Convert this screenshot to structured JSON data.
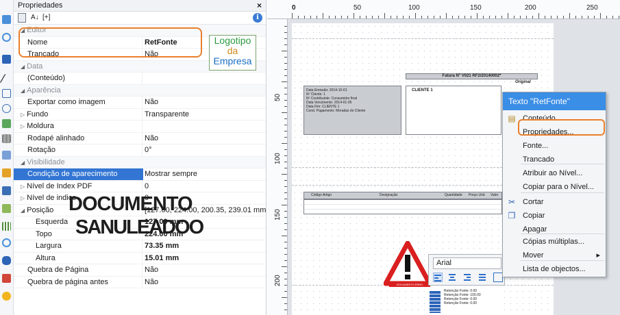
{
  "panel": {
    "title": "Propriedades",
    "close": "×",
    "sort_az": "A↓",
    "sort_cat": "[+]",
    "info": "i"
  },
  "grid": [
    {
      "type": "cat",
      "key": "Editor"
    },
    {
      "type": "prop",
      "key": "Nome",
      "value": "RetFonte",
      "bold_value": true
    },
    {
      "type": "prop",
      "key": "Trancado",
      "value": "Não"
    },
    {
      "type": "cat",
      "key": "Data"
    },
    {
      "type": "prop",
      "key": "(Conteúdo)",
      "value": ""
    },
    {
      "type": "cat",
      "key": "Aparência"
    },
    {
      "type": "prop",
      "key": "Exportar como imagem",
      "value": "Não"
    },
    {
      "type": "prop",
      "key": "Fundo",
      "value": "Transparente",
      "expand": true
    },
    {
      "type": "prop",
      "key": "Moldura",
      "value": "",
      "expand": true
    },
    {
      "type": "prop",
      "key": "Rodapé alinhado",
      "value": "Não"
    },
    {
      "type": "prop",
      "key": "Rotação",
      "value": "0°"
    },
    {
      "type": "cat",
      "key": "Visibilidade"
    },
    {
      "type": "prop",
      "key": "Condição de aparecimento",
      "value": "Mostrar sempre",
      "selected": true
    },
    {
      "type": "prop",
      "key": "Nível de Index PDF",
      "value": "0",
      "expand": true
    },
    {
      "type": "prop",
      "key": "Nível de indice",
      "value": "0",
      "expand": true
    },
    {
      "type": "prop",
      "key": "Posição",
      "value": "[127.00, 224.00, 200.35, 239.01 mm]",
      "expanded": true
    },
    {
      "type": "sub",
      "key": "Esquerda",
      "value": "127.00 mm",
      "bold_value": true
    },
    {
      "type": "sub",
      "key": "Topo",
      "value": "224.00 mm",
      "bold_value": true
    },
    {
      "type": "sub",
      "key": "Largura",
      "value": "73.35 mm",
      "bold_value": true
    },
    {
      "type": "sub",
      "key": "Altura",
      "value": "15.01 mm",
      "bold_value": true
    },
    {
      "type": "prop",
      "key": "Quebra de Página",
      "value": "Não"
    },
    {
      "type": "prop",
      "key": "Quebra de página antes",
      "value": "Não"
    }
  ],
  "ruler": {
    "h": [
      "0",
      "50",
      "100",
      "150",
      "200",
      "250"
    ],
    "v": [
      "50",
      "100",
      "150",
      "200"
    ]
  },
  "report": {
    "logo": [
      "Logotipo",
      "da",
      "Empresa"
    ],
    "invoice": "Fatura Nº V021 RF2/20140002*",
    "original": "Original",
    "client": "CLIENTE 1",
    "watermark1": "DOCUMENTO",
    "watermark2": "SANULEADOO",
    "info_lines": [
      "Data Emissão: 2014-10-01",
      "Nº Cliente: 1",
      "Nº Contribuinte: Consumidor final",
      "Data Vencimento: 2014-01-05",
      "Data Fim: CLIENTE 1",
      "Cond. Pagamento: Moradas do Cliente"
    ],
    "table_head": [
      "Código Artigo",
      "Designação",
      "Quantidade",
      "Preço Unit.",
      "Valor"
    ],
    "footer_lines": [
      "Retenção Fonte: 0.00",
      "Retenção Fonte: 100.00",
      "Retenção Fonte: 0.00",
      "Retenção Fonte: 0.00"
    ],
    "warning_label": "DOCUMENTO ERRO"
  },
  "context_menu": {
    "title": "Texto \"RetFonte\"",
    "items": [
      {
        "label": "Conteúdo",
        "icon": "content-icon"
      },
      {
        "label": "Propriedades...",
        "icon": ""
      },
      {
        "label": "Fonte...",
        "icon": ""
      },
      {
        "label": "Trancado",
        "icon": ""
      },
      {
        "label": "Atribuir ao Nível...",
        "icon": ""
      },
      {
        "label": "Copiar para o Nível...",
        "icon": ""
      },
      {
        "label": "Cortar",
        "icon": "scissors-icon"
      },
      {
        "label": "Copiar",
        "icon": "copy-icon"
      },
      {
        "label": "Apagar",
        "icon": ""
      },
      {
        "label": "Cópias múltiplas...",
        "icon": ""
      },
      {
        "label": "Mover",
        "icon": "",
        "submenu": true
      },
      {
        "label": "Lista de objectos...",
        "icon": ""
      }
    ]
  },
  "font_toolbar": {
    "font": "Arial"
  }
}
